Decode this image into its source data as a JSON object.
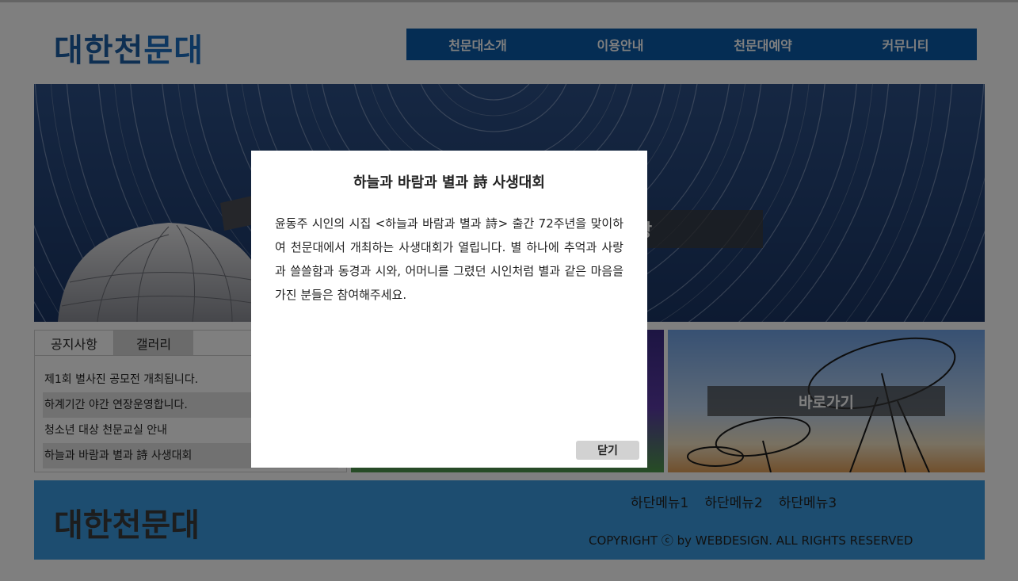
{
  "header": {
    "logo_part1": "대한천",
    "logo_part2": "문대",
    "nav": [
      "천문대소개",
      "이용안내",
      "천문대예약",
      "커뮤니티"
    ]
  },
  "hero": {
    "banner_text": "장"
  },
  "tabs": {
    "labels": [
      "공지사항",
      "갤러리"
    ],
    "notices": [
      "제1회 별사진 공모전 개최됩니다.",
      "하계기간 야간 연장운영합니다.",
      "청소년 대상 천문교실 안내",
      "하늘과 바람과 별과 詩 사생대회"
    ]
  },
  "shortcut": {
    "label": "바로가기"
  },
  "footer": {
    "logo": "대한천문대",
    "menu": [
      "하단메뉴1",
      "하단메뉴2",
      "하단메뉴3"
    ],
    "copyright": "COPYRIGHT ⓒ by WEBDESIGN. ALL RIGHTS RESERVED"
  },
  "modal": {
    "title": "하늘과 바람과 별과 詩 사생대회",
    "body": "윤동주 시인의 시집 <하늘과 바람과 별과 詩> 출간 72주년을 맞이하여 천문대에서 개최하는 사생대회가 열립니다. 별 하나에 추억과 사랑과 쓸쓸함과 동경과 시와, 어머니를 그렸던 시인처럼 별과 같은 마음을 가진 분들은 참여해주세요.",
    "close_label": "닫기"
  },
  "colors": {
    "nav_bg": "#0a5aa8",
    "logo": "#1d5fa5",
    "footer_bg": "#3a9be0",
    "overlay": "rgba(0,0,0,0.5)"
  }
}
